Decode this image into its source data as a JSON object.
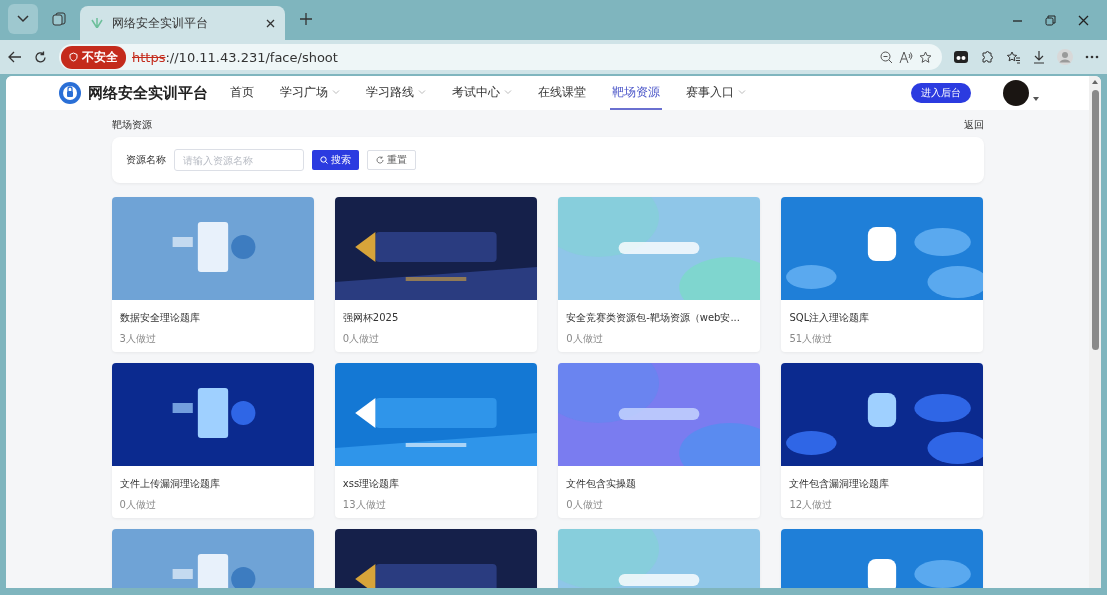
{
  "browser": {
    "tab_title": "网络安全实训平台",
    "security_badge": "不安全",
    "url_scheme": "https",
    "url_rest": "://10.11.43.231/face/shoot"
  },
  "header": {
    "site_name": "网络安全实训平台",
    "nav": [
      {
        "label": "首页",
        "selected": false,
        "has_menu": false
      },
      {
        "label": "学习广场",
        "selected": false,
        "has_menu": true
      },
      {
        "label": "学习路线",
        "selected": false,
        "has_menu": true
      },
      {
        "label": "考试中心",
        "selected": false,
        "has_menu": true
      },
      {
        "label": "在线课堂",
        "selected": false,
        "has_menu": false
      },
      {
        "label": "靶场资源",
        "selected": true,
        "has_menu": false
      },
      {
        "label": "赛事入口",
        "selected": false,
        "has_menu": true
      }
    ],
    "admin_button": "进入后台"
  },
  "breadcrumb": "靶场资源",
  "back_link": "返回",
  "search": {
    "label": "资源名称",
    "placeholder": "请输入资源名称",
    "search_button": "搜索",
    "reset_button": "重置"
  },
  "cards": [
    {
      "image": {
        "kind": "picture"
      },
      "title": "数据安全理论题库",
      "done_count": "3人做过"
    },
    {
      "image": {
        "kind": "picture"
      },
      "title": "强网杯2025",
      "done_count": "0人做过"
    },
    {
      "image": {
        "kind": "picture"
      },
      "title": "安全竞赛类资源包-靶场资源（web安...",
      "done_count": "0人做过"
    },
    {
      "image": {
        "kind": "picture"
      },
      "title": "SQL注入理论题库",
      "done_count": "51人做过"
    },
    {
      "image": {
        "kind": "picture"
      },
      "title": "文件上传漏洞理论题库",
      "done_count": "0人做过"
    },
    {
      "image": {
        "kind": "picture"
      },
      "title": "xss理论题库",
      "done_count": "13人做过"
    },
    {
      "image": {
        "kind": "picture"
      },
      "title": "文件包含实操题",
      "done_count": "0人做过"
    },
    {
      "image": {
        "kind": "picture"
      },
      "title": "文件包含漏洞理论题库",
      "done_count": "12人做过"
    },
    {
      "image": {
        "kind": "picture"
      }
    },
    {
      "image": {
        "kind": "picture"
      }
    },
    {
      "image": {
        "kind": "picture"
      }
    },
    {
      "image": {
        "kind": "picture"
      }
    }
  ]
}
